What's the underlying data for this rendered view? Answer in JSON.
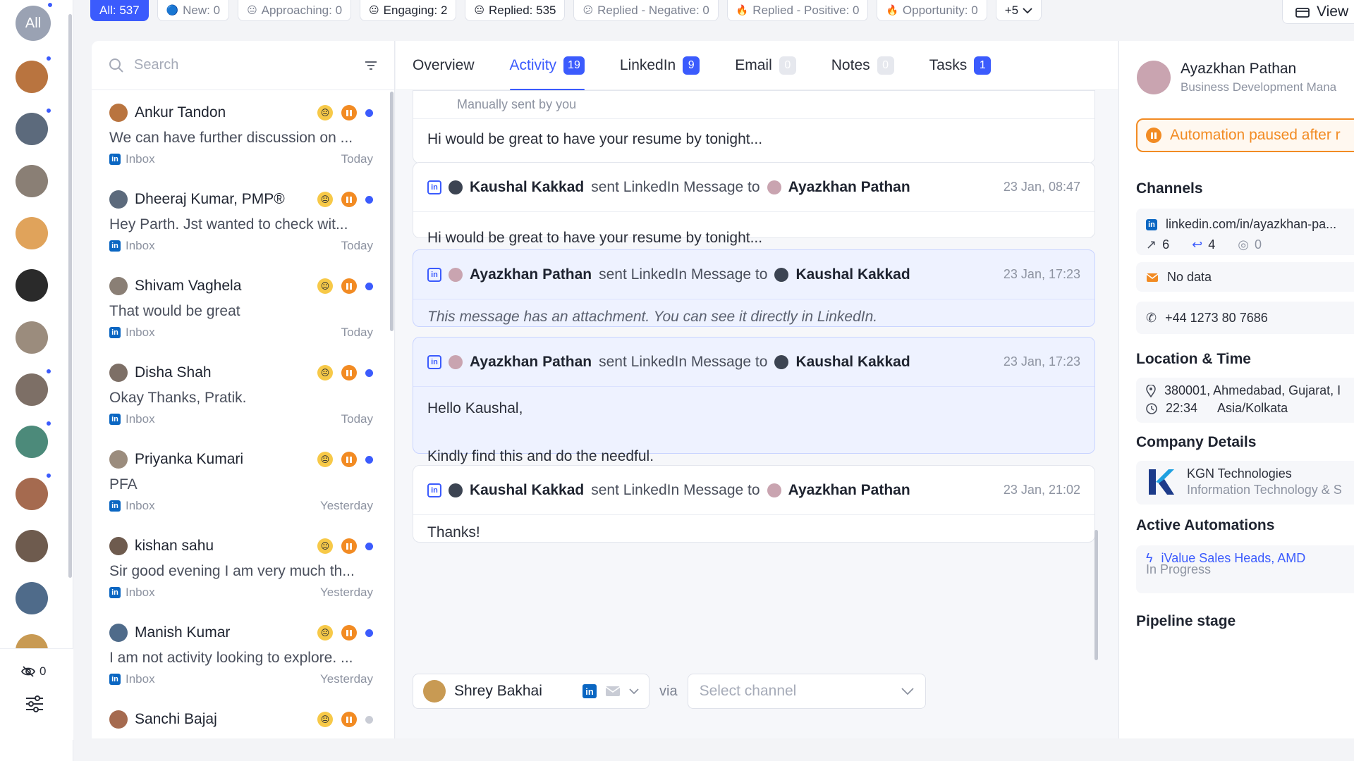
{
  "rail": {
    "all_label": "All",
    "hidden_count": "0",
    "avatar_colors": [
      "#b9743f",
      "#5c6a7c",
      "#8a7f75",
      "#e0a35b",
      "#2a2a2a",
      "#9b8c7d",
      "#7d6f66",
      "#4c8a7a",
      "#a56a4f",
      "#6e5b4e",
      "#4f6b8a",
      "#c89a53"
    ]
  },
  "filters": [
    {
      "label": "All: 537",
      "emoji": "",
      "active": true
    },
    {
      "label": "New: 0",
      "emoji": "🔵"
    },
    {
      "label": "Approaching: 0",
      "emoji": "😐"
    },
    {
      "label": "Engaging: 2",
      "emoji": "😐",
      "dark": true
    },
    {
      "label": "Replied: 535",
      "emoji": "😐",
      "dark": true
    },
    {
      "label": "Replied - Negative: 0",
      "emoji": "😕"
    },
    {
      "label": "Replied - Positive: 0",
      "emoji": "🔥"
    },
    {
      "label": "Opportunity: 0",
      "emoji": "🔥"
    },
    {
      "label": "+5",
      "emoji": "",
      "dark": true,
      "chevron": true
    }
  ],
  "view_label": "View",
  "search": {
    "placeholder": "Search"
  },
  "conversations": [
    {
      "name": "Ankur Tandon",
      "preview": "We can have further discussion on ...",
      "channel": "Inbox",
      "time": "Today",
      "avatar": "#b9743f",
      "dot": "blue"
    },
    {
      "name": "Dheeraj Kumar, PMP®",
      "preview": "Hey Parth. Jst wanted to check wit...",
      "channel": "Inbox",
      "time": "Today",
      "avatar": "#5c6a7c",
      "dot": "blue"
    },
    {
      "name": "Shivam Vaghela",
      "preview": "That would be great",
      "channel": "Inbox",
      "time": "Today",
      "avatar": "#8a7f75",
      "dot": "blue"
    },
    {
      "name": "Disha Shah",
      "preview": "Okay Thanks, Pratik.",
      "channel": "Inbox",
      "time": "Today",
      "avatar": "#7d6f66",
      "dot": "blue"
    },
    {
      "name": "Priyanka Kumari",
      "preview": "PFA",
      "channel": "Inbox",
      "time": "Yesterday",
      "avatar": "#9b8c7d",
      "dot": "blue"
    },
    {
      "name": "kishan sahu",
      "preview": "Sir good evening I am very much th...",
      "channel": "Inbox",
      "time": "Yesterday",
      "avatar": "#6e5b4e",
      "dot": "blue"
    },
    {
      "name": "Manish Kumar",
      "preview": "I am not activity looking to explore. ...",
      "channel": "Inbox",
      "time": "Yesterday",
      "avatar": "#4f6b8a",
      "dot": "blue"
    },
    {
      "name": "Sanchi Bajaj",
      "preview": "",
      "channel": "",
      "time": "",
      "avatar": "#a56a4f",
      "dot": "grey"
    }
  ],
  "tabs": [
    {
      "label": "Overview",
      "count": null
    },
    {
      "label": "Activity",
      "count": "19",
      "active": true
    },
    {
      "label": "LinkedIn",
      "count": "9"
    },
    {
      "label": "Email",
      "count": "0",
      "zero": true
    },
    {
      "label": "Notes",
      "count": "0",
      "zero": true
    },
    {
      "label": "Tasks",
      "count": "1"
    }
  ],
  "messages": {
    "partial": {
      "sub": "Manually sent by you",
      "body": "Hi would be great to have your resume by tonight..."
    },
    "m1": {
      "from": "Kaushal Kakkad",
      "verb": "sent LinkedIn Message to",
      "to": "Ayazkhan Pathan",
      "time": "23 Jan, 08:47",
      "body": "Hi would be great to have your resume by tonight..."
    },
    "m2": {
      "from": "Ayazkhan Pathan",
      "verb": "sent LinkedIn Message to",
      "to": "Kaushal Kakkad",
      "time": "23 Jan, 17:23",
      "body": "This message has an attachment. You can see it directly in LinkedIn."
    },
    "m3": {
      "from": "Ayazkhan Pathan",
      "verb": "sent LinkedIn Message to",
      "to": "Kaushal Kakkad",
      "time": "23 Jan, 17:23",
      "body1": "Hello Kaushal,",
      "body2": "Kindly find this and do the needful."
    },
    "m4": {
      "from": "Kaushal Kakkad",
      "verb": "sent LinkedIn Message to",
      "to": "Ayazkhan Pathan",
      "time": "23 Jan, 21:02",
      "body": "Thanks!"
    }
  },
  "composer": {
    "sender": "Shrey Bakhai",
    "via": "via",
    "channel_placeholder": "Select channel"
  },
  "profile": {
    "name": "Ayazkhan Pathan",
    "title": "Business Development Mana",
    "paused": "Automation paused after r",
    "channels_title": "Channels",
    "linkedin_url": "linkedin.com/in/ayazkhan-pa...",
    "stat_sent": "6",
    "stat_replied": "4",
    "stat_views": "0",
    "email": "No data",
    "phone": "+44 1273 80 7686",
    "location_title": "Location & Time",
    "location": "380001, Ahmedabad, Gujarat, I",
    "local_time": "22:34",
    "timezone": "Asia/Kolkata",
    "company_title": "Company Details",
    "company_name": "KGN Technologies",
    "company_industry": "Information Technology & S",
    "automations_title": "Active Automations",
    "automation_name": "iValue Sales Heads, AMD",
    "automation_status": "In Progress",
    "pipeline_title": "Pipeline stage"
  }
}
